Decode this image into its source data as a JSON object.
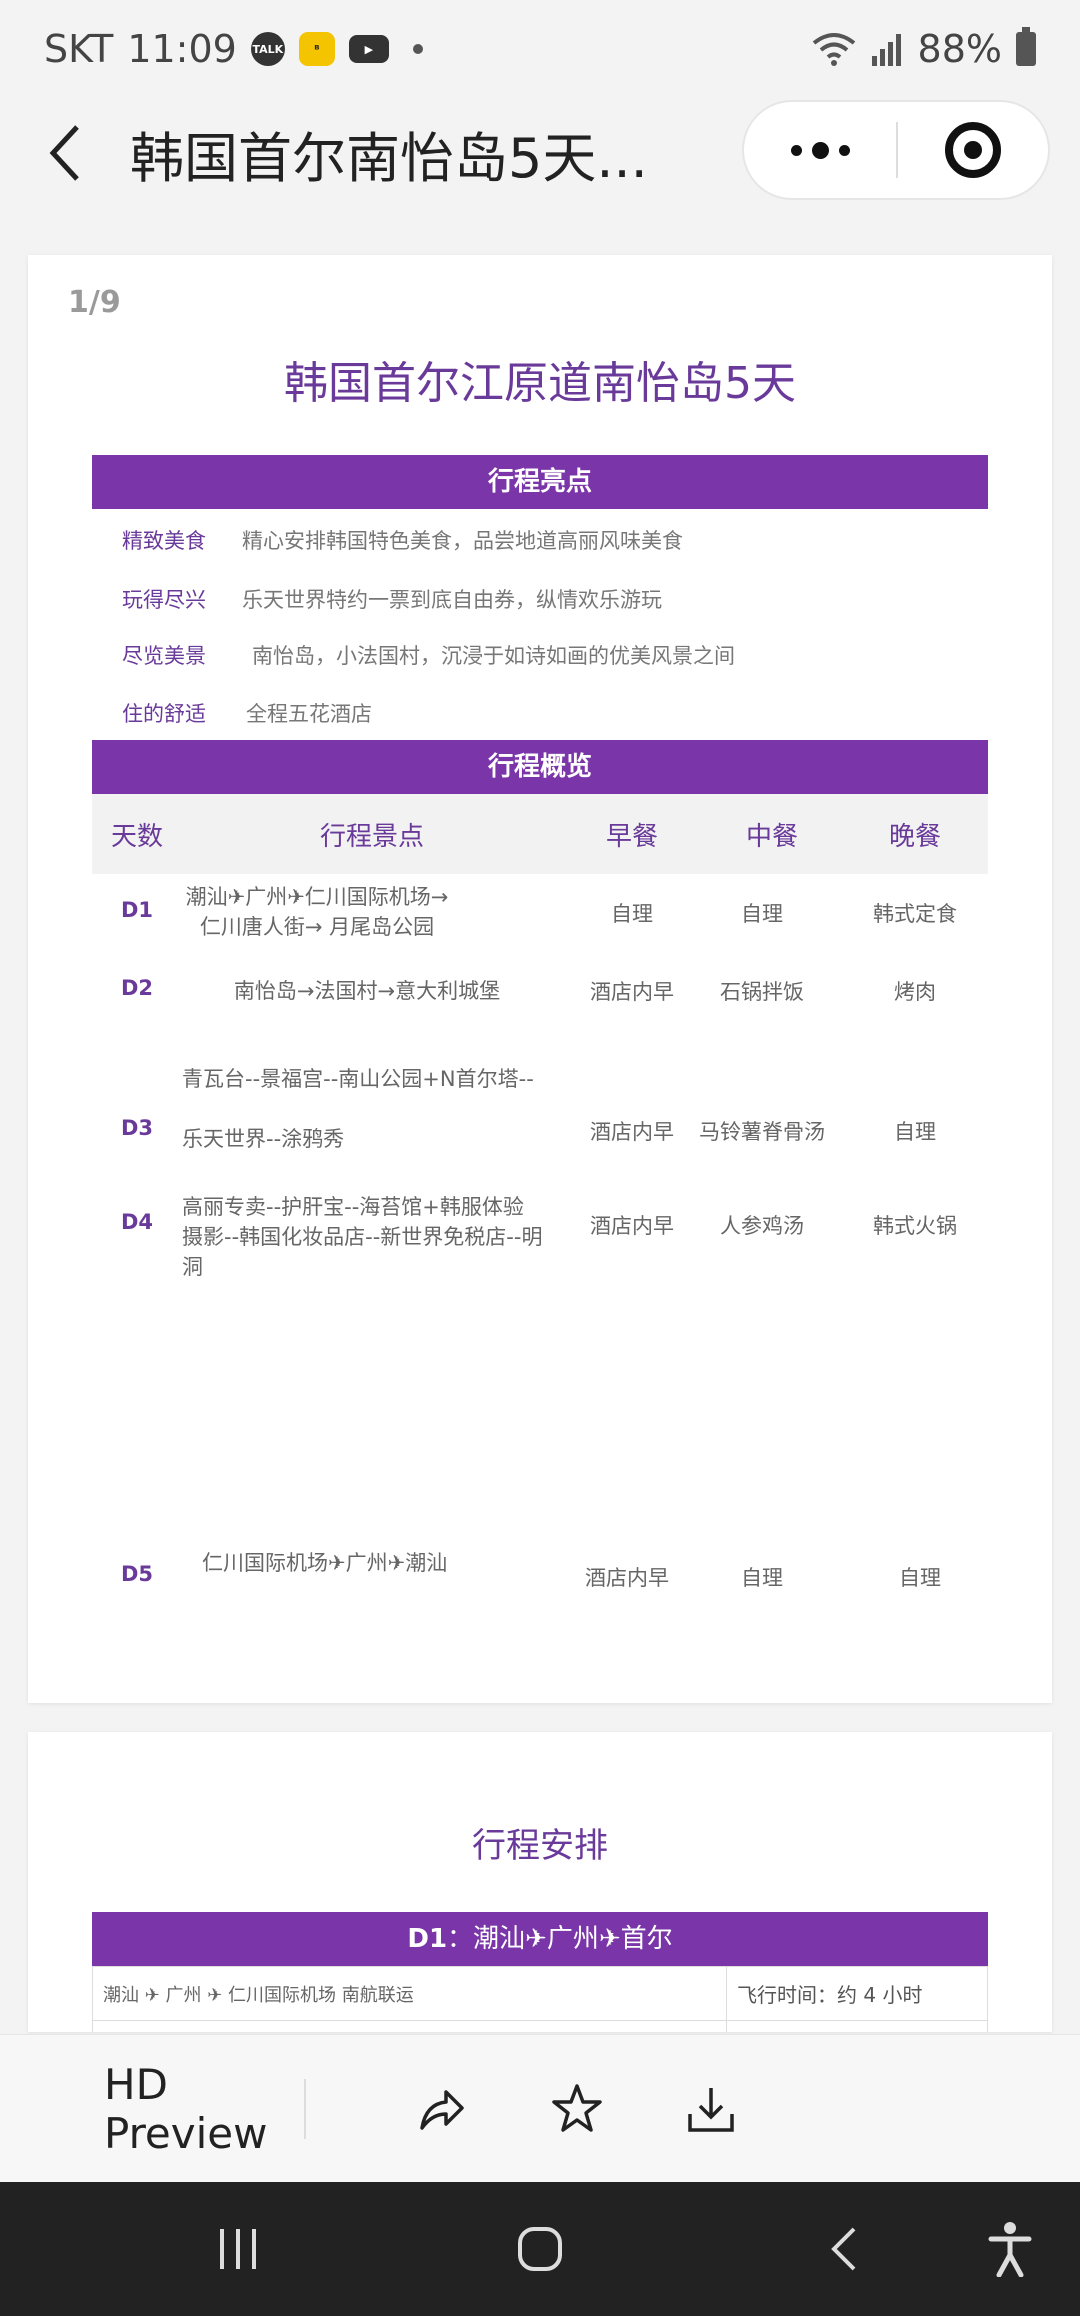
{
  "status_bar": {
    "carrier": "SKT",
    "time": "11:09",
    "talk_badge": "TALK",
    "yellow_app": "ᴮ",
    "battery": "88%"
  },
  "header": {
    "title": "韩国首尔南怡岛5天..."
  },
  "page1": {
    "page_num": "1/9",
    "doc_title": "韩国首尔江原道南怡岛5天",
    "highlights_title": "行程亮点",
    "highlights": [
      {
        "label": "精致美食",
        "value": "精心安排韩国特色美食，品尝地道高丽风味美食"
      },
      {
        "label": "玩得尽兴",
        "value": "乐天世界特约一票到底自由券，纵情欢乐游玩"
      },
      {
        "label": "尽览美景",
        "value": "南怡岛，小法国村，沉浸于如诗如画的优美风景之间"
      },
      {
        "label": "住的舒适",
        "value": "全程五花酒店"
      }
    ],
    "overview_title": "行程概览",
    "columns": [
      "天数",
      "行程景点",
      "早餐",
      "中餐",
      "晚餐"
    ],
    "rows": [
      {
        "day": "D1",
        "schedule": "潮汕✈广州✈仁川国际机场→仁川唐人街→ 月尾岛公园",
        "breakfast": "自理",
        "lunch": "自理",
        "dinner": "韩式定食"
      },
      {
        "day": "D2",
        "schedule": "南怡岛→法国村→意大利城堡",
        "breakfast": "酒店内早",
        "lunch": "石锅拌饭",
        "dinner": "烤肉"
      },
      {
        "day": "D3",
        "schedule": "青瓦台--景福宫--南山公园+N首尔塔--",
        "schedule2": "乐天世界--涂鸦秀",
        "breakfast": "酒店内早",
        "lunch": "马铃薯脊骨汤",
        "dinner": "自理"
      },
      {
        "day": "D4",
        "schedule": "高丽专卖--护肝宝--海苔馆+韩服体验摄影--韩国化妆品店--新世界免税店--明洞",
        "breakfast": "酒店内早",
        "lunch": "人参鸡汤",
        "dinner": "韩式火锅"
      },
      {
        "day": "D5",
        "schedule": "仁川国际机场✈广州✈潮汕",
        "breakfast": "酒店内早",
        "lunch": "自理",
        "dinner": "自理"
      }
    ]
  },
  "page2": {
    "title": "行程安排",
    "d1_day": "D1",
    "d1_route": "：潮汕✈广州✈首尔",
    "d1_flight": "潮汕 ✈  广州  ✈  仁川国际机场      南航联运",
    "d1_flight_time": "飞行时间：约 4 小时"
  },
  "toolbar": {
    "preview_label": "HD Preview"
  }
}
